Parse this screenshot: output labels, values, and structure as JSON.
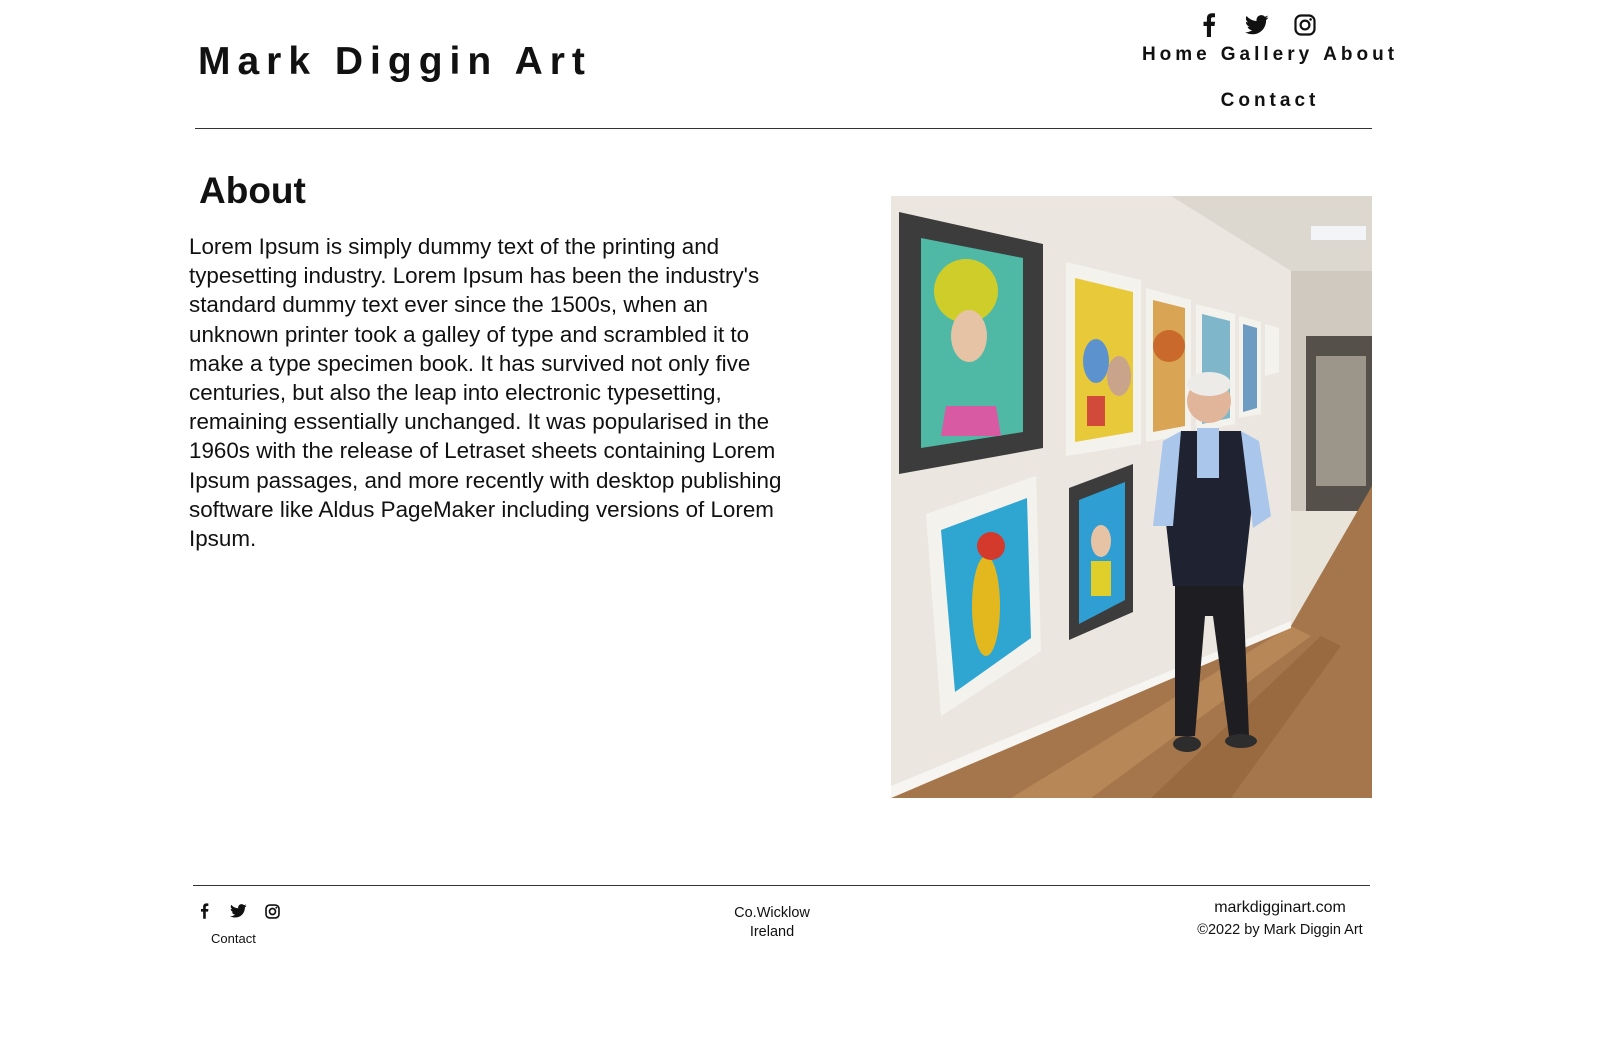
{
  "site": {
    "title": "Mark Diggin Art"
  },
  "header": {
    "social_icons": [
      "facebook-icon",
      "twitter-icon",
      "instagram-icon"
    ],
    "nav": {
      "home": "Home",
      "gallery": "Gallery",
      "about": "About",
      "contact": "Contact"
    }
  },
  "about": {
    "heading": "About",
    "body": "Lorem Ipsum is simply dummy text of the printing and typesetting industry. Lorem Ipsum has been the industry's standard dummy text ever since the 1500s, when an unknown printer took a galley of type and scrambled it to make a type specimen book. It has survived not only five centuries, but also the leap into electronic typesetting, remaining essentially unchanged. It was popularised in the 1960s with the release of Letraset sheets containing Lorem Ipsum passages, and more recently with desktop publishing software like Aldus PageMaker including versions of Lorem Ipsum."
  },
  "footer": {
    "social_icons": [
      "facebook-icon",
      "twitter-icon",
      "instagram-icon"
    ],
    "contact_link": "Contact",
    "location_line1": "Co.Wicklow",
    "location_line2": "Ireland",
    "domain": "markdigginart.com",
    "copyright": "©2022 by Mark Diggin Art"
  },
  "colors": {
    "text": "#111111",
    "rule": "#333333",
    "background": "#ffffff"
  }
}
